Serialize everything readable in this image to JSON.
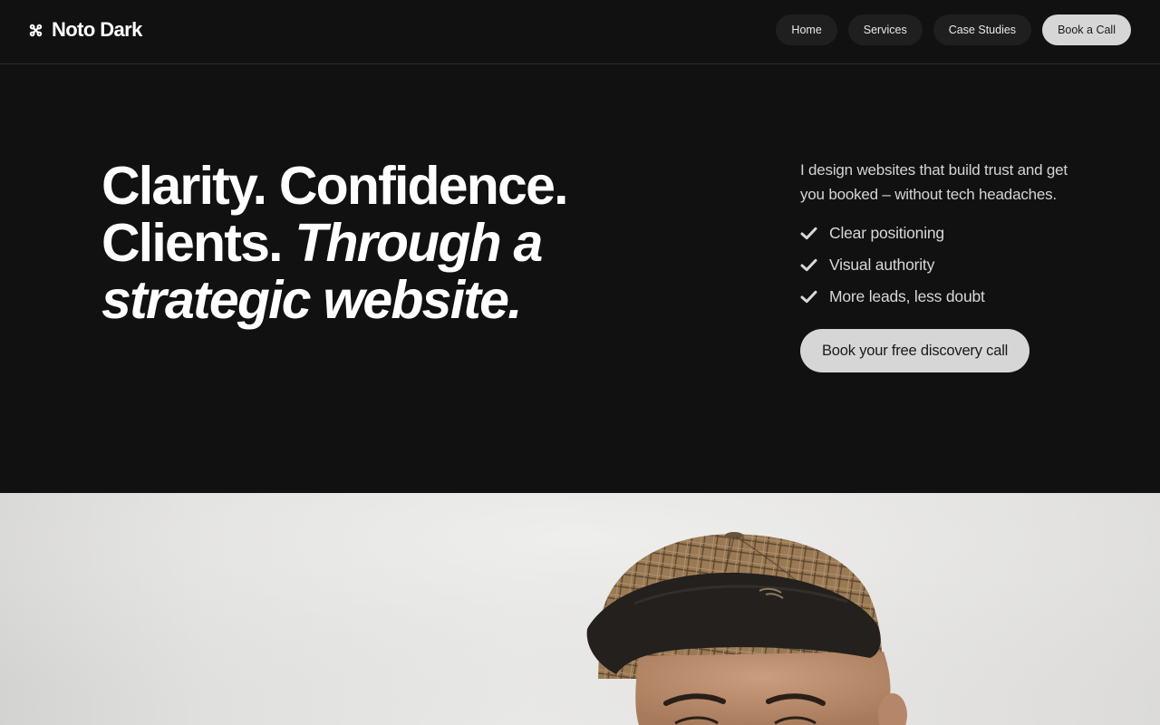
{
  "brand": {
    "icon": "command-icon",
    "name": "Noto Dark"
  },
  "nav": {
    "items": [
      {
        "label": "Home"
      },
      {
        "label": "Services"
      },
      {
        "label": "Case Studies"
      }
    ],
    "cta_label": "Book a Call"
  },
  "hero": {
    "headline_line1": "Clarity. Confidence.",
    "headline_line2_plain": "Clients.",
    "headline_line2_italic": "Through a",
    "headline_line3_italic": "strategic website.",
    "intro": "I design websites that build trust and get you booked – without tech headaches.",
    "checklist": [
      {
        "icon": "checkmark-icon",
        "label": "Clear positioning"
      },
      {
        "icon": "checkmark-icon",
        "label": "Visual authority"
      },
      {
        "icon": "checkmark-icon",
        "label": "More leads, less doubt"
      }
    ],
    "cta_label": "Book your free discovery call"
  },
  "colors": {
    "background": "#111111",
    "nav_pill": "#1f1f1f",
    "cta": "#d6d6d6",
    "text_primary": "#ffffff",
    "text_secondary": "#d4d4d4"
  }
}
